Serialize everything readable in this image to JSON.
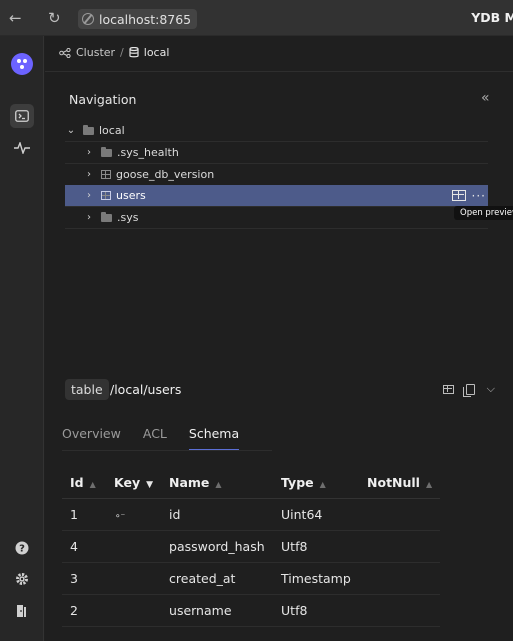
{
  "browser": {
    "back_icon": "arrow-left-icon",
    "reload_icon": "reload-icon",
    "url": "localhost:8765",
    "title": "YDB M"
  },
  "sidebar": {
    "logo_icon": "ydb-logo-icon",
    "items": [
      "terminal-icon",
      "activity-icon"
    ],
    "bottom_items": [
      "help-icon",
      "settings-icon",
      "logout-icon"
    ]
  },
  "breadcrumb": {
    "cluster": "Cluster",
    "separator": "/",
    "database": "local"
  },
  "navigation": {
    "title": "Navigation",
    "collapse_label": "«",
    "tree": [
      {
        "label": "local",
        "type": "folder",
        "expanded": true
      },
      {
        "label": ".sys_health",
        "type": "folder"
      },
      {
        "label": "goose_db_version",
        "type": "table"
      },
      {
        "label": "users",
        "type": "table",
        "selected": true
      },
      {
        "label": ".sys",
        "type": "folder"
      }
    ],
    "more_label": "···",
    "tooltip": "Open preview"
  },
  "object": {
    "type": "table",
    "path": "/local/users"
  },
  "tabs": [
    {
      "label": "Overview",
      "active": false
    },
    {
      "label": "ACL",
      "active": false
    },
    {
      "label": "Schema",
      "active": true
    }
  ],
  "schema": {
    "columns": [
      "Id",
      "Key",
      "Name",
      "Type",
      "NotNull"
    ],
    "rows": [
      {
        "id": "1",
        "key": "key-icon",
        "name": "id",
        "type": "Uint64",
        "notnull": ""
      },
      {
        "id": "4",
        "key": "",
        "name": "password_hash",
        "type": "Utf8",
        "notnull": ""
      },
      {
        "id": "3",
        "key": "",
        "name": "created_at",
        "type": "Timestamp",
        "notnull": ""
      },
      {
        "id": "2",
        "key": "",
        "name": "username",
        "type": "Utf8",
        "notnull": ""
      }
    ]
  },
  "colors": {
    "accent": "#5b6fd6",
    "selected_row": "#4d5b8a",
    "logo": "#6c63ff"
  }
}
